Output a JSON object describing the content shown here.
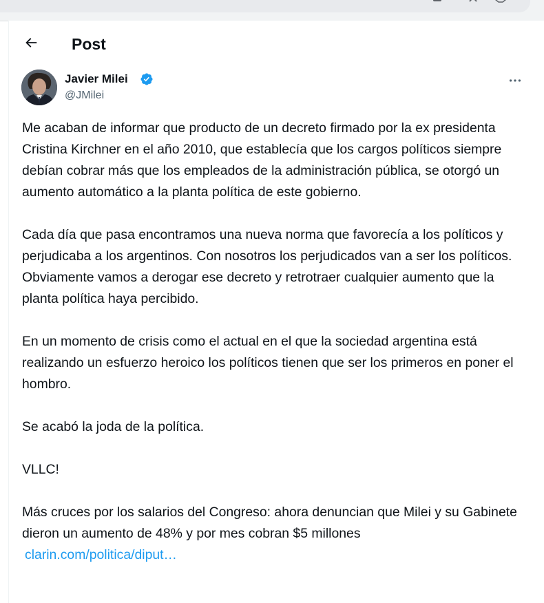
{
  "browser": {
    "url_fragment": "1740503688624297"
  },
  "header": {
    "title": "Post"
  },
  "author": {
    "name": "Javier Milei",
    "handle": "@JMilei"
  },
  "tweet": {
    "paragraphs": [
      "Me acaban de informar que producto de un decreto firmado por la ex presidenta Cristina Kirchner en el año 2010, que establecía que los cargos políticos siempre debían cobrar más que los empleados de la administración pública, se otorgó un aumento automático a la planta política de este gobierno.",
      "Cada día que pasa encontramos una nueva norma que favorecía a los políticos y perjudicaba a los argentinos. Con nosotros los perjudicados van a ser los políticos. Obviamente vamos a derogar ese decreto y retrotraer cualquier aumento que la planta política haya percibido.",
      "En un momento de crisis como el actual en el que la sociedad argentina está realizando un esfuerzo heroico los políticos tienen que ser los primeros en poner el hombro.",
      "Se acabó la joda de la política.",
      "VLLC!",
      "Más cruces por los salarios del Congreso: ahora denuncian que Milei y su Gabinete dieron un aumento de 48% y por mes cobran $5 millones"
    ],
    "link_text": "clarin.com/politica/diput…"
  },
  "colors": {
    "accent": "#1d9bf0",
    "text": "#0f1419",
    "secondary_text": "#536471"
  },
  "icons": {
    "back": "arrow-left-icon",
    "verified": "verified-badge-icon",
    "more": "more-horizontal-icon"
  }
}
